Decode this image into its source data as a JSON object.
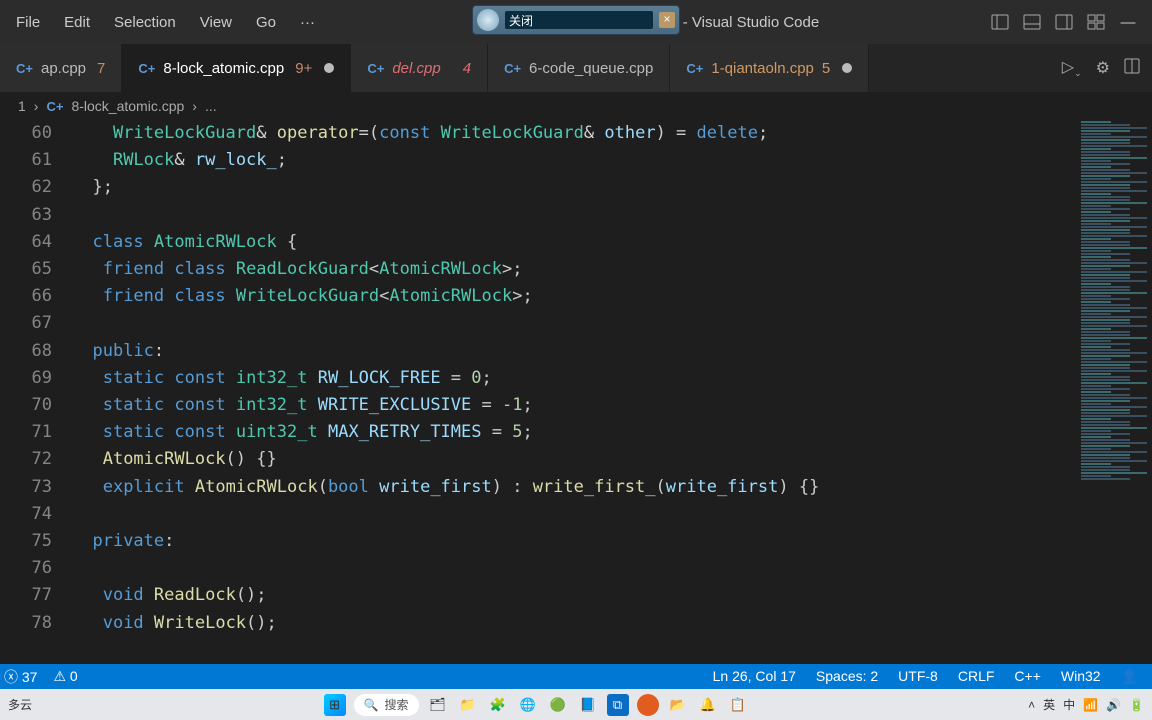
{
  "menu": {
    "items": [
      "File",
      "Edit",
      "Selection",
      "View",
      "Go"
    ],
    "overflow": "···"
  },
  "title": "8-lock_atomic.cpp - code - Visual Studio Code",
  "tabs": [
    {
      "icon": "C+",
      "name": "ap.cpp",
      "badge": "7",
      "badgeClass": "badge"
    },
    {
      "icon": "C+",
      "name": "8-lock_atomic.cpp",
      "badge": "9+",
      "badgeClass": "badge",
      "modified": true,
      "active": true
    },
    {
      "icon": "C+",
      "name": "del.cpp",
      "badge": "4",
      "badgeClass": "badge-red",
      "nameClass": "badge-red"
    },
    {
      "icon": "C+",
      "name": "6-code_queue.cpp"
    },
    {
      "icon": "C+",
      "name": "1-qiantaoln.cpp",
      "badge": "5",
      "badgeClass": "badge-orange",
      "nameClass": "badge-orange",
      "modified": true
    }
  ],
  "breadcrumb": {
    "num": "1",
    "file": "8-lock_atomic.cpp",
    "more": "..."
  },
  "code_lines": [
    {
      "ln": 60,
      "html": "    <span class='tk-type'>WriteLockGuard</span><span class='tk-op'>&</span> <span class='tk-fn'>operator</span><span class='tk-op'>=</span>(<span class='tk-kw'>const</span> <span class='tk-type'>WriteLockGuard</span><span class='tk-op'>&</span> <span class='tk-var'>other</span>) = <span class='tk-kw'>delete</span>;"
    },
    {
      "ln": 61,
      "html": "    <span class='tk-type'>RWLock</span><span class='tk-op'>&</span> <span class='tk-var'>rw_lock_</span>;"
    },
    {
      "ln": 62,
      "html": "  };"
    },
    {
      "ln": 63,
      "html": " "
    },
    {
      "ln": 64,
      "html": "  <span class='tk-kw'>class</span> <span class='tk-type'>AtomicRWLock</span> {"
    },
    {
      "ln": 65,
      "html": "   <span class='tk-kw'>friend</span> <span class='tk-kw'>class</span> <span class='tk-type'>ReadLockGuard</span>&lt;<span class='tk-type'>AtomicRWLock</span>&gt;;"
    },
    {
      "ln": 66,
      "html": "   <span class='tk-kw'>friend</span> <span class='tk-kw'>class</span> <span class='tk-type'>WriteLockGuard</span>&lt;<span class='tk-type'>AtomicRWLock</span>&gt;;"
    },
    {
      "ln": 67,
      "html": " "
    },
    {
      "ln": 68,
      "html": "  <span class='tk-kw'>public</span>:"
    },
    {
      "ln": 69,
      "html": "   <span class='tk-kw'>static</span> <span class='tk-kw'>const</span> <span class='tk-type'>int32_t</span> <span class='tk-var'>RW_LOCK_FREE</span> = <span class='tk-num'>0</span>;"
    },
    {
      "ln": 70,
      "html": "   <span class='tk-kw'>static</span> <span class='tk-kw'>const</span> <span class='tk-type'>int32_t</span> <span class='tk-var'>WRITE_EXCLUSIVE</span> = <span class='tk-num'>-1</span>;"
    },
    {
      "ln": 71,
      "html": "   <span class='tk-kw'>static</span> <span class='tk-kw'>const</span> <span class='tk-type'>uint32_t</span> <span class='tk-var'>MAX_RETRY_TIMES</span> = <span class='tk-num'>5</span>;"
    },
    {
      "ln": 72,
      "html": "   <span class='tk-fn'>AtomicRWLock</span>() {}"
    },
    {
      "ln": 73,
      "html": "   <span class='tk-kw'>explicit</span> <span class='tk-fn'>AtomicRWLock</span>(<span class='tk-kw'>bool</span> <span class='tk-var'>write_first</span>) : <span class='tk-fn'>write_first_</span>(<span class='tk-var'>write_first</span>) {}"
    },
    {
      "ln": 74,
      "html": " "
    },
    {
      "ln": 75,
      "html": "  <span class='tk-kw'>private</span>:"
    },
    {
      "ln": 76,
      "html": " "
    },
    {
      "ln": 77,
      "html": "   <span class='tk-kw'>void</span> <span class='tk-fn'>ReadLock</span>();"
    },
    {
      "ln": 78,
      "html": "   <span class='tk-kw'>void</span> <span class='tk-fn'>WriteLock</span>();"
    }
  ],
  "status": {
    "errors": "37",
    "warnings": "0",
    "pos": "Ln 26, Col 17",
    "spaces": "Spaces: 2",
    "encoding": "UTF-8",
    "eol": "CRLF",
    "lang": "C++",
    "platform": "Win32"
  },
  "taskbar": {
    "left": "多云",
    "search": "搜索",
    "tray_lang": "英",
    "tray_ime": "中"
  },
  "floating": {
    "label": "关闭"
  }
}
